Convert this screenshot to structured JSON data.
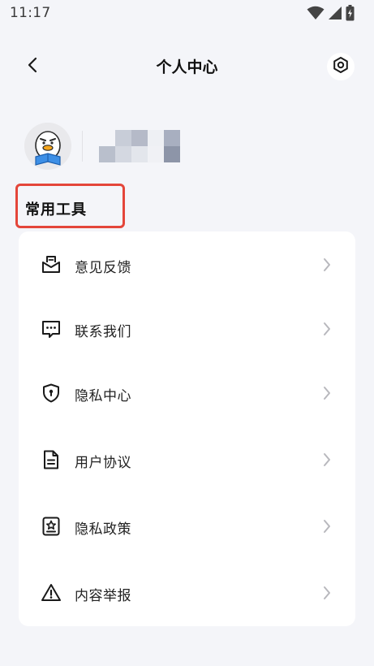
{
  "status_bar": {
    "time": "11:17",
    "icons": [
      "wifi-icon",
      "cellular-signal-icon",
      "battery-charging-icon"
    ]
  },
  "nav": {
    "title": "个人中心",
    "back_icon": "chevron-left-icon",
    "settings_icon": "settings-hexagon-icon"
  },
  "profile": {
    "avatar_icon": "duck-avatar-icon",
    "username_redacted": true
  },
  "section": {
    "title": "常用工具",
    "highlight_color": "#e4463a"
  },
  "menu": {
    "items": [
      {
        "label": "意见反馈",
        "icon": "feedback-envelope-icon"
      },
      {
        "label": "联系我们",
        "icon": "chat-bubble-icon"
      },
      {
        "label": "隐私中心",
        "icon": "shield-lock-icon"
      },
      {
        "label": "用户协议",
        "icon": "document-icon"
      },
      {
        "label": "隐私政策",
        "icon": "badge-star-icon"
      },
      {
        "label": "内容举报",
        "icon": "warning-triangle-icon"
      }
    ]
  },
  "colors": {
    "background": "#f4f5f9",
    "card": "#ffffff",
    "chevron": "#b8b8bd"
  }
}
